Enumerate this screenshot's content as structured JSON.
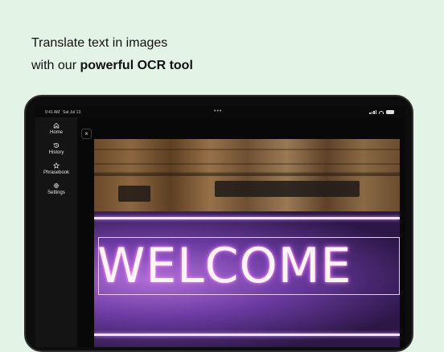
{
  "headline": {
    "line1": "Translate text in images",
    "line2_prefix": "with our ",
    "line2_bold": "powerful OCR tool"
  },
  "status_bar": {
    "time": "9:41 AM",
    "date": "Sat Jul 13",
    "dots": "•••"
  },
  "sidebar": {
    "items": [
      {
        "label": "Home",
        "icon": "home-icon"
      },
      {
        "label": "History",
        "icon": "history-icon"
      },
      {
        "label": "Phrasebook",
        "icon": "star-icon"
      },
      {
        "label": "Settings",
        "icon": "gear-icon"
      }
    ]
  },
  "viewer": {
    "close_label": "×",
    "image_text": "WELCOME"
  },
  "colors": {
    "background": "#e3f4e6",
    "device": "#0d0d0d",
    "neon": "#b06fd6"
  }
}
